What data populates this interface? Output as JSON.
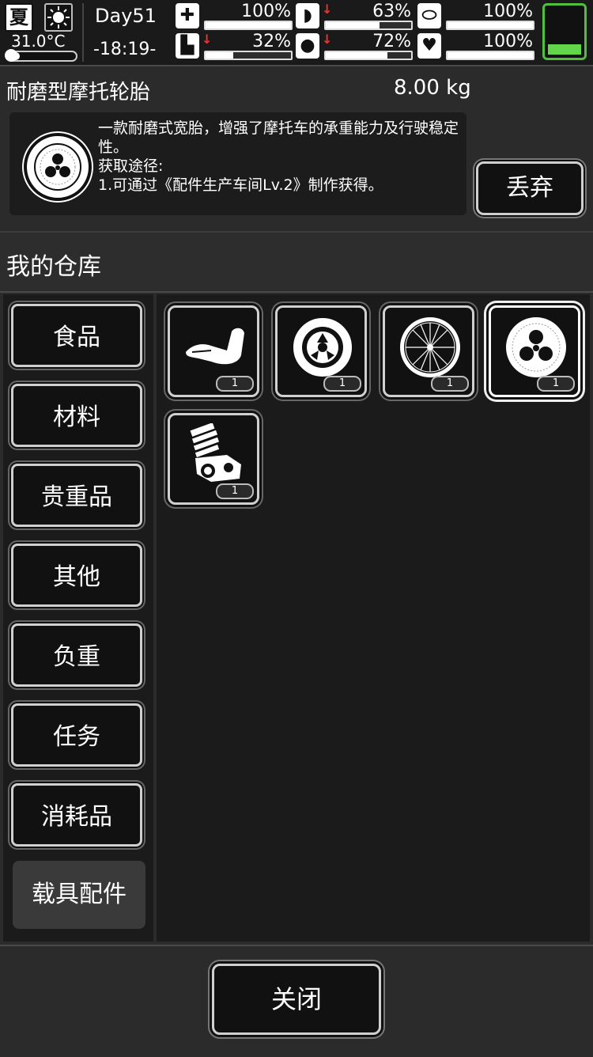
{
  "status": {
    "season": "夏",
    "weather_icon": "sun-icon",
    "temperature": "31.0°C",
    "day": "Day51",
    "time": "-18:19-",
    "stats": [
      {
        "name": "health",
        "icon": "medkit-icon",
        "pct": "100%",
        "level": 1.0,
        "falling": false
      },
      {
        "name": "hunger",
        "icon": "stomach-icon",
        "pct": "63%",
        "level": 0.63,
        "falling": true
      },
      {
        "name": "medicine",
        "icon": "pill-icon",
        "pct": "100%",
        "level": 1.0,
        "falling": false
      },
      {
        "name": "stamina",
        "icon": "boot-icon",
        "pct": "32%",
        "level": 0.32,
        "falling": true
      },
      {
        "name": "thirst",
        "icon": "water-drop-icon",
        "pct": "72%",
        "level": 0.72,
        "falling": true
      },
      {
        "name": "mood",
        "icon": "heart-icon",
        "pct": "100%",
        "level": 1.0,
        "falling": false
      }
    ],
    "battery_level": 0.2,
    "battery_color": "#62d54a"
  },
  "detail": {
    "name": "耐磨型摩托轮胎",
    "weight": "8.00 kg",
    "description": "一款耐磨式宽胎，增强了摩托车的承重能力及行驶稳定性。\n获取途径:\n1.可通过《配件生产车间Lv.2》制作获得。",
    "discard_label": "丢弃"
  },
  "warehouse": {
    "title": "我的仓库",
    "categories": [
      "食品",
      "材料",
      "贵重品",
      "其他",
      "负重",
      "任务",
      "消耗品",
      "载具配件"
    ],
    "active_category": "载具配件",
    "items": [
      {
        "icon": "motorcycle-seat-icon",
        "count": "1"
      },
      {
        "icon": "tire-icon",
        "count": "1"
      },
      {
        "icon": "spoked-wheel-icon",
        "count": "1"
      },
      {
        "icon": "wear-resistant-tire-icon",
        "count": "1",
        "selected": true
      },
      {
        "icon": "engine-icon",
        "count": "1"
      }
    ]
  },
  "footer": {
    "close_label": "关闭"
  }
}
